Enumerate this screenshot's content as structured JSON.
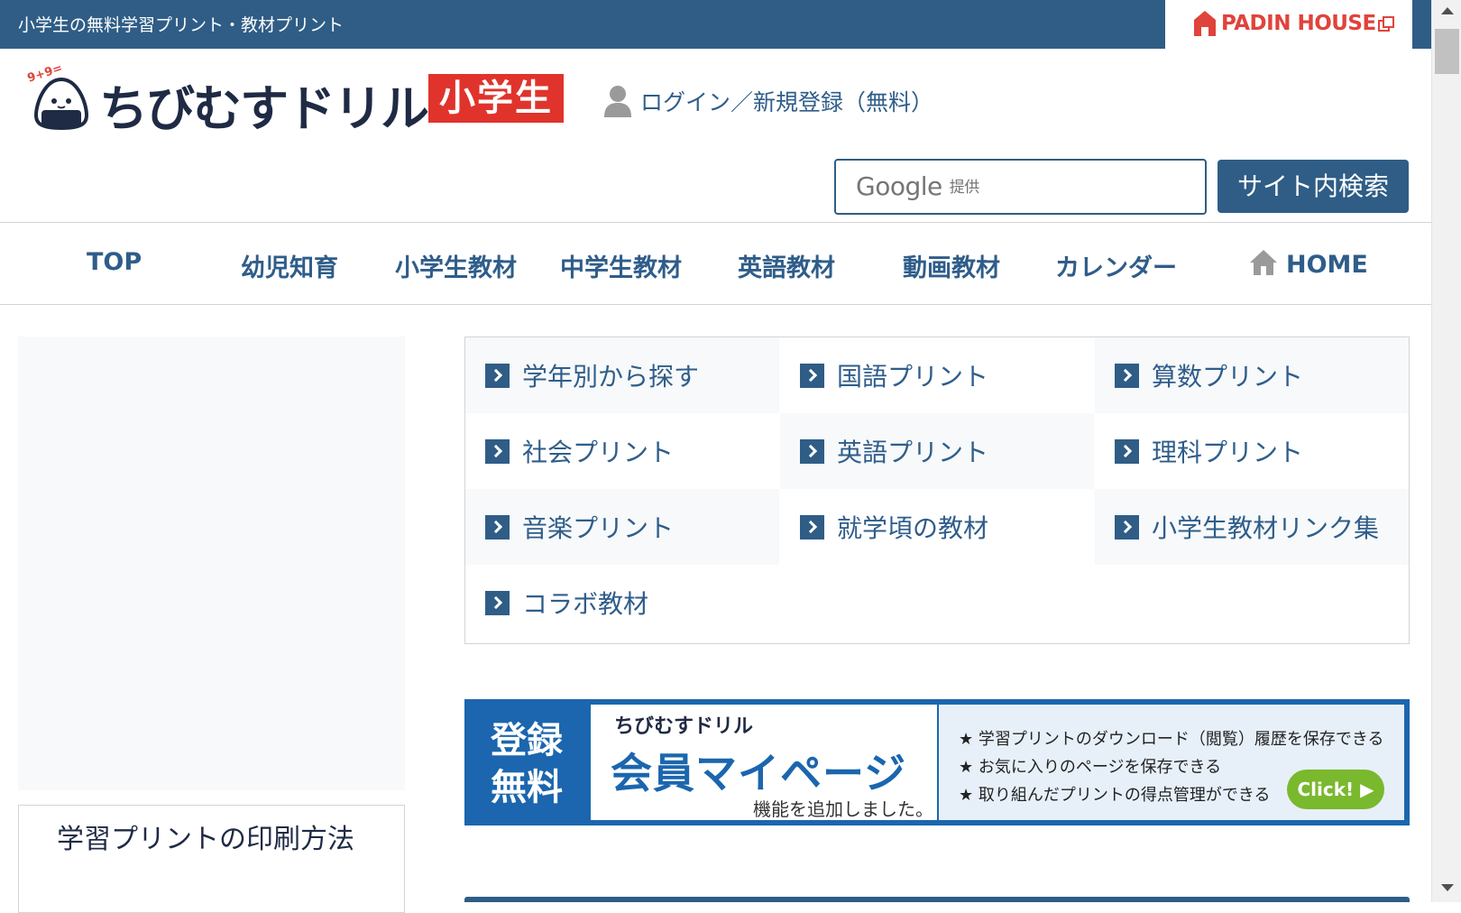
{
  "topbar": {
    "text": "小学生の無料学習プリント・教材プリント",
    "partner": "PADIN HOUSE"
  },
  "header": {
    "logo_math": "9+9=",
    "logo_name": "ちびむすドリル",
    "logo_badge": "小学生",
    "login_text": "ログイン／新規登録（無料）"
  },
  "search": {
    "google_text": "Google",
    "google_sub": "提供",
    "button_label": "サイト内検索"
  },
  "nav": {
    "items": [
      "TOP",
      "幼児知育",
      "小学生教材",
      "中学生教材",
      "英語教材",
      "動画教材",
      "カレンダー",
      "HOME"
    ]
  },
  "links": {
    "items": [
      "学年別から探す",
      "国語プリント",
      "算数プリント",
      "社会プリント",
      "英語プリント",
      "理科プリント",
      "音楽プリント",
      "就学頃の教材",
      "小学生教材リンク集",
      "コラボ教材"
    ]
  },
  "sidebar": {
    "print_title": "学習プリントの印刷方法"
  },
  "banner": {
    "left_line1": "登録",
    "left_line2": "無料",
    "logo": "ちびむすドリル",
    "title": "会員マイページ",
    "subtitle": "機能を追加しました。",
    "features": [
      "★ 学習プリントのダウンロード（閲覧）履歴を保存できる",
      "★ お気に入りのページを保存できる",
      "★ 取り組んだプリントの得点管理ができる"
    ],
    "click_label": "Click! ▶"
  },
  "colors": {
    "primary": "#2f5d86",
    "accent_red": "#e0332c",
    "banner_blue": "#1b66ae",
    "click_green": "#7ab82e"
  }
}
